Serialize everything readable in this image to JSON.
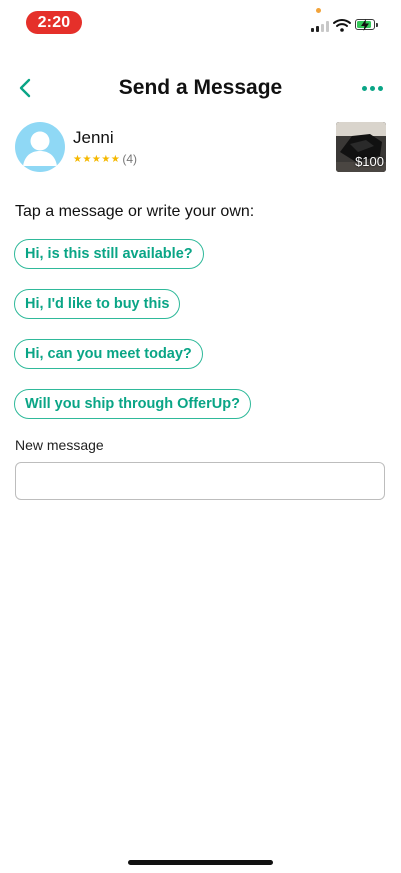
{
  "status_bar": {
    "time": "2:20",
    "icons": [
      "cellular-signal-icon",
      "wifi-icon",
      "battery-charging-icon"
    ]
  },
  "header": {
    "title": "Send a Message",
    "back_icon": "chevron-left-icon",
    "more_icon": "more-dots-icon"
  },
  "seller": {
    "name": "Jenni",
    "stars": "★★★★★",
    "rating_count": "(4)",
    "avatar_icon": "user-avatar-icon"
  },
  "item": {
    "price": "$100"
  },
  "prompt": "Tap a message or write your own:",
  "suggestions": [
    "Hi, is this still available?",
    "Hi, I'd like to buy this",
    "Hi, can you meet today?",
    "Will you ship through OfferUp?"
  ],
  "new_message": {
    "label": "New message",
    "value": "",
    "placeholder": ""
  },
  "colors": {
    "accent": "#0aa586",
    "chip_border": "#2fb99a",
    "time_pill": "#e5302a",
    "star": "#f5b800",
    "avatar_bg": "#8fd8f5"
  }
}
